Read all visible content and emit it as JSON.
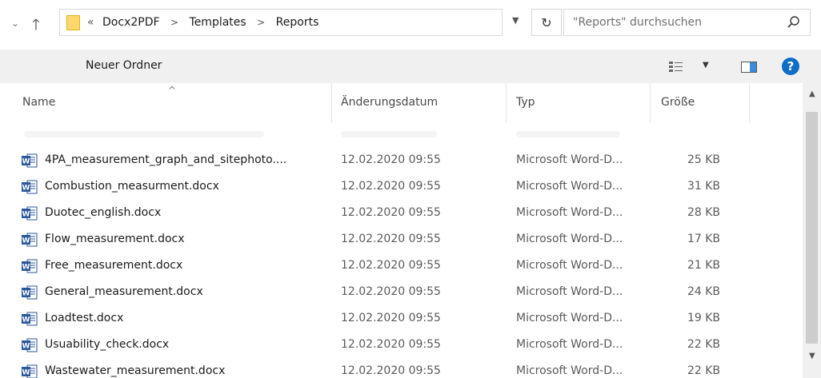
{
  "addressbar": {
    "overflow": "«",
    "crumbs": [
      "Docx2PDF",
      "Templates",
      "Reports"
    ],
    "search_placeholder": "\"Reports\" durchsuchen"
  },
  "commandbar": {
    "new_folder": "Neuer Ordner",
    "help": "?"
  },
  "columns": {
    "name": "Name",
    "date": "Änderungsdatum",
    "type": "Typ",
    "size": "Größe"
  },
  "files": [
    {
      "name": "4PA_measurement_graph_and_sitephoto....",
      "date": "12.02.2020 09:55",
      "type": "Microsoft Word-D...",
      "size": "25 KB"
    },
    {
      "name": "Combustion_measurment.docx",
      "date": "12.02.2020 09:55",
      "type": "Microsoft Word-D...",
      "size": "31 KB"
    },
    {
      "name": "Duotec_english.docx",
      "date": "12.02.2020 09:55",
      "type": "Microsoft Word-D...",
      "size": "28 KB"
    },
    {
      "name": "Flow_measurement.docx",
      "date": "12.02.2020 09:55",
      "type": "Microsoft Word-D...",
      "size": "17 KB"
    },
    {
      "name": "Free_measurement.docx",
      "date": "12.02.2020 09:55",
      "type": "Microsoft Word-D...",
      "size": "21 KB"
    },
    {
      "name": "General_measurement.docx",
      "date": "12.02.2020 09:55",
      "type": "Microsoft Word-D...",
      "size": "24 KB"
    },
    {
      "name": "Loadtest.docx",
      "date": "12.02.2020 09:55",
      "type": "Microsoft Word-D...",
      "size": "19 KB"
    },
    {
      "name": "Usuability_check.docx",
      "date": "12.02.2020 09:55",
      "type": "Microsoft Word-D...",
      "size": "22 KB"
    },
    {
      "name": "Wastewater_measurement.docx",
      "date": "12.02.2020 09:55",
      "type": "Microsoft Word-D...",
      "size": "22 KB"
    }
  ],
  "icons": {
    "back": "chevron-down-icon",
    "up": "arrow-up-icon",
    "folder": "folder-icon",
    "refresh": "refresh-icon",
    "search": "search-icon",
    "view": "details-view-icon",
    "pane": "preview-pane-icon",
    "file": "word-document-icon"
  },
  "colors": {
    "accent": "#0f6cc7",
    "folder": "#ffd86b",
    "word": "#2b579a",
    "commandbar_bg": "#f0f0f0"
  }
}
